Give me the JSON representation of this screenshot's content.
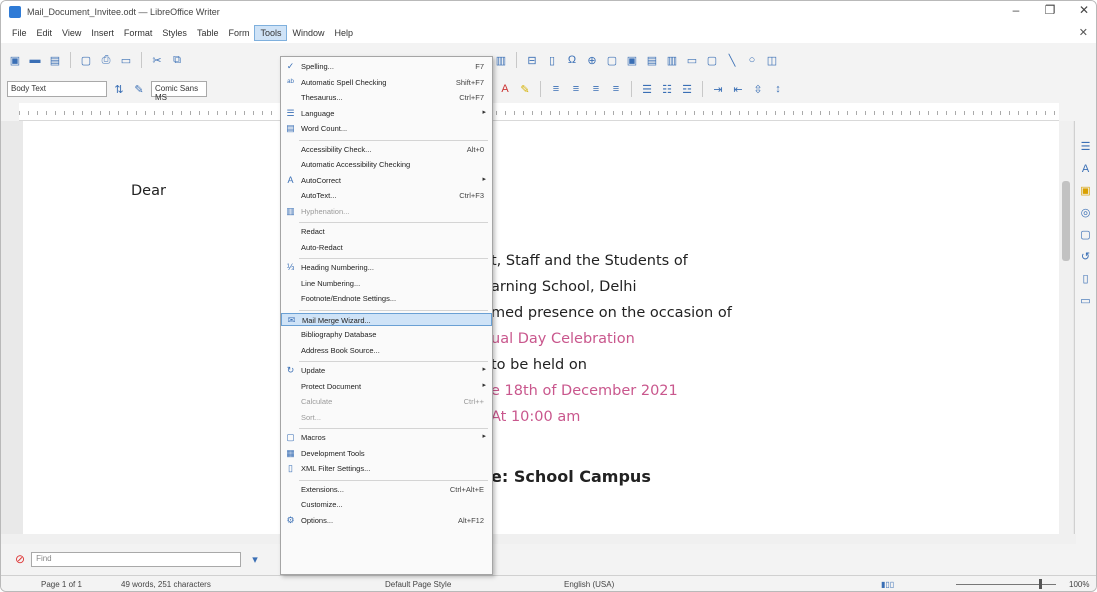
{
  "window": {
    "title": "Mail_Document_Invitee.odt — LibreOffice Writer"
  },
  "menubar": {
    "items": [
      "File",
      "Edit",
      "View",
      "Insert",
      "Format",
      "Styles",
      "Table",
      "Form",
      "Tools",
      "Window",
      "Help"
    ],
    "active": "Tools"
  },
  "toolbar": {
    "paragraph_style": "Body Text",
    "font_name": "Comic Sans MS"
  },
  "document": {
    "lines": [
      "Dear",
      "t, Staff and the Students of",
      "arning School, Delhi",
      "med presence on the occasion of",
      "ual Day Celebration",
      "to be held on",
      "e 18th of December 2021",
      "At 10:00 am",
      "e: School Campus"
    ]
  },
  "tools_menu": {
    "items": [
      {
        "label": "Spelling...",
        "shortcut": "F7",
        "icon": "spelling-icon"
      },
      {
        "label": "Automatic Spell Checking",
        "shortcut": "Shift+F7",
        "icon": "autospell-icon"
      },
      {
        "label": "Thesaurus...",
        "shortcut": "Ctrl+F7"
      },
      {
        "label": "Language",
        "submenu": true,
        "icon": "language-icon"
      },
      {
        "label": "Word Count...",
        "icon": "word-count-icon"
      },
      {
        "label": "Accessibility Check...",
        "shortcut": "Alt+0"
      },
      {
        "label": "Automatic Accessibility Checking"
      },
      {
        "label": "AutoCorrect",
        "submenu": true,
        "icon": "autocorrect-icon"
      },
      {
        "label": "AutoText...",
        "shortcut": "Ctrl+F3"
      },
      {
        "label": "Hyphenation...",
        "disabled": true,
        "icon": "hyphenation-icon"
      },
      {
        "label": "Redact"
      },
      {
        "label": "Auto-Redact"
      },
      {
        "label": "Heading Numbering...",
        "icon": "heading-numbering-icon"
      },
      {
        "label": "Line Numbering..."
      },
      {
        "label": "Footnote/Endnote Settings..."
      },
      {
        "label": "Mail Merge Wizard...",
        "highlight": true,
        "icon": "mail-merge-icon"
      },
      {
        "label": "Bibliography Database"
      },
      {
        "label": "Address Book Source..."
      },
      {
        "label": "Update",
        "submenu": true,
        "icon": "update-icon"
      },
      {
        "label": "Protect Document",
        "submenu": true
      },
      {
        "label": "Calculate",
        "shortcut": "Ctrl++",
        "disabled": true
      },
      {
        "label": "Sort...",
        "disabled": true
      },
      {
        "label": "Macros",
        "submenu": true,
        "icon": "macros-icon"
      },
      {
        "label": "Development Tools",
        "icon": "dev-tools-icon"
      },
      {
        "label": "XML Filter Settings...",
        "icon": "xml-filter-icon"
      },
      {
        "label": "Extensions...",
        "shortcut": "Ctrl+Alt+E"
      },
      {
        "label": "Customize..."
      },
      {
        "label": "Options...",
        "shortcut": "Alt+F12",
        "icon": "options-icon"
      }
    ]
  },
  "findbar": {
    "placeholder": "Find"
  },
  "statusbar": {
    "page": "Page 1 of 1",
    "words": "49 words, 251 characters",
    "page_style": "Default Page Style",
    "language": "English (USA)",
    "zoom": "100%"
  },
  "colors": {
    "accent": "#3a6fb5",
    "highlight": "#cfe3f7",
    "pink_text": "#c9578d"
  }
}
